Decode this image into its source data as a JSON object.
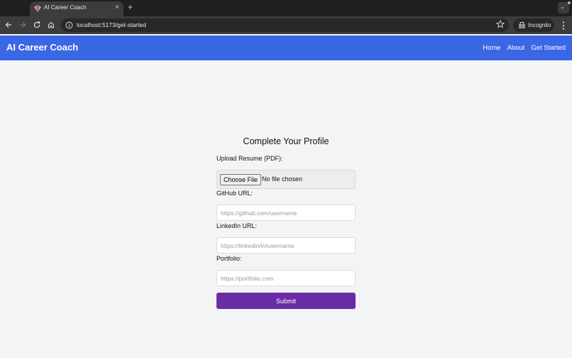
{
  "browser": {
    "tab_title": "AI Career Coach",
    "tab_close": "×",
    "new_tab": "+",
    "url": "localhost:5173/get-started",
    "incognito_label": "Incognito",
    "tab_menu": "⌄"
  },
  "app": {
    "brand": "AI Career Coach",
    "nav": [
      "Home",
      "About",
      "Get Started"
    ],
    "brand_color": "#3b67e6"
  },
  "form": {
    "title": "Complete Your Profile",
    "resume_label": "Upload Resume (PDF):",
    "choose_file": "Choose File",
    "file_status": "No file chosen",
    "github_label": "GitHub URL:",
    "github_placeholder": "https://github.com/username",
    "linkedin_label": "LinkedIn URL:",
    "linkedin_placeholder": "https://linkedin/in/username",
    "portfolio_label": "Portfolio:",
    "portfolio_placeholder": "https://portfolio.com",
    "submit": "Submit",
    "submit_color": "#6a2ca5"
  }
}
